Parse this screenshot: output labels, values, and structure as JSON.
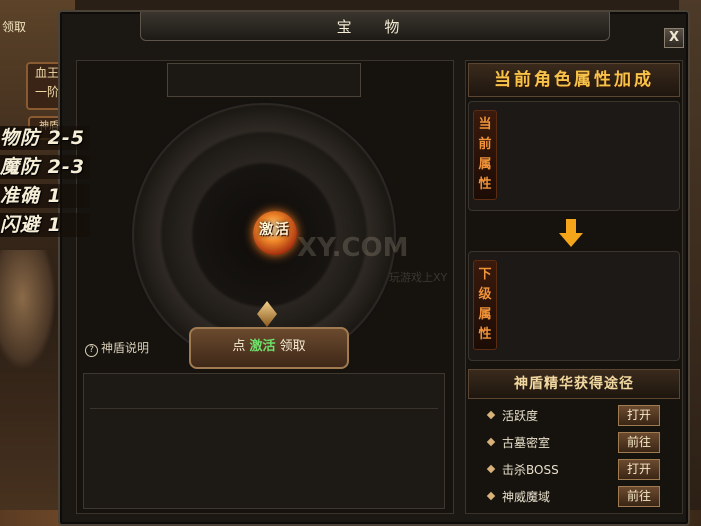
{
  "background": {
    "claim_text": "领取",
    "side_button": "血王\n一阶",
    "side_button_2": "神盾",
    "stats": [
      "物防 2-5",
      "魔防 2-3",
      "准确 1",
      "闪避 1"
    ]
  },
  "window": {
    "title": "宝 物",
    "close_label": "X"
  },
  "left": {
    "orb_label": "激活",
    "watermark": "XY.COM",
    "watermark_sub": "玩游戏上XY",
    "help_label": "神盾说明",
    "help_icon": "?",
    "claim_prefix": "点",
    "claim_action": "激活",
    "claim_suffix": "领取"
  },
  "right": {
    "header": "当前角色属性加成",
    "current_tag": "当前属性",
    "next_tag": "下级属性",
    "sources_header": "神盾精华获得途径",
    "sources": [
      {
        "name": "活跃度",
        "button": "打开"
      },
      {
        "name": "古墓密室",
        "button": "前往"
      },
      {
        "name": "击杀BOSS",
        "button": "打开"
      },
      {
        "name": "神威魔域",
        "button": "前往"
      }
    ]
  },
  "colors": {
    "gold": "#f7c44a",
    "arrow": "#f5a51a",
    "activate_green": "#6ee06a"
  }
}
